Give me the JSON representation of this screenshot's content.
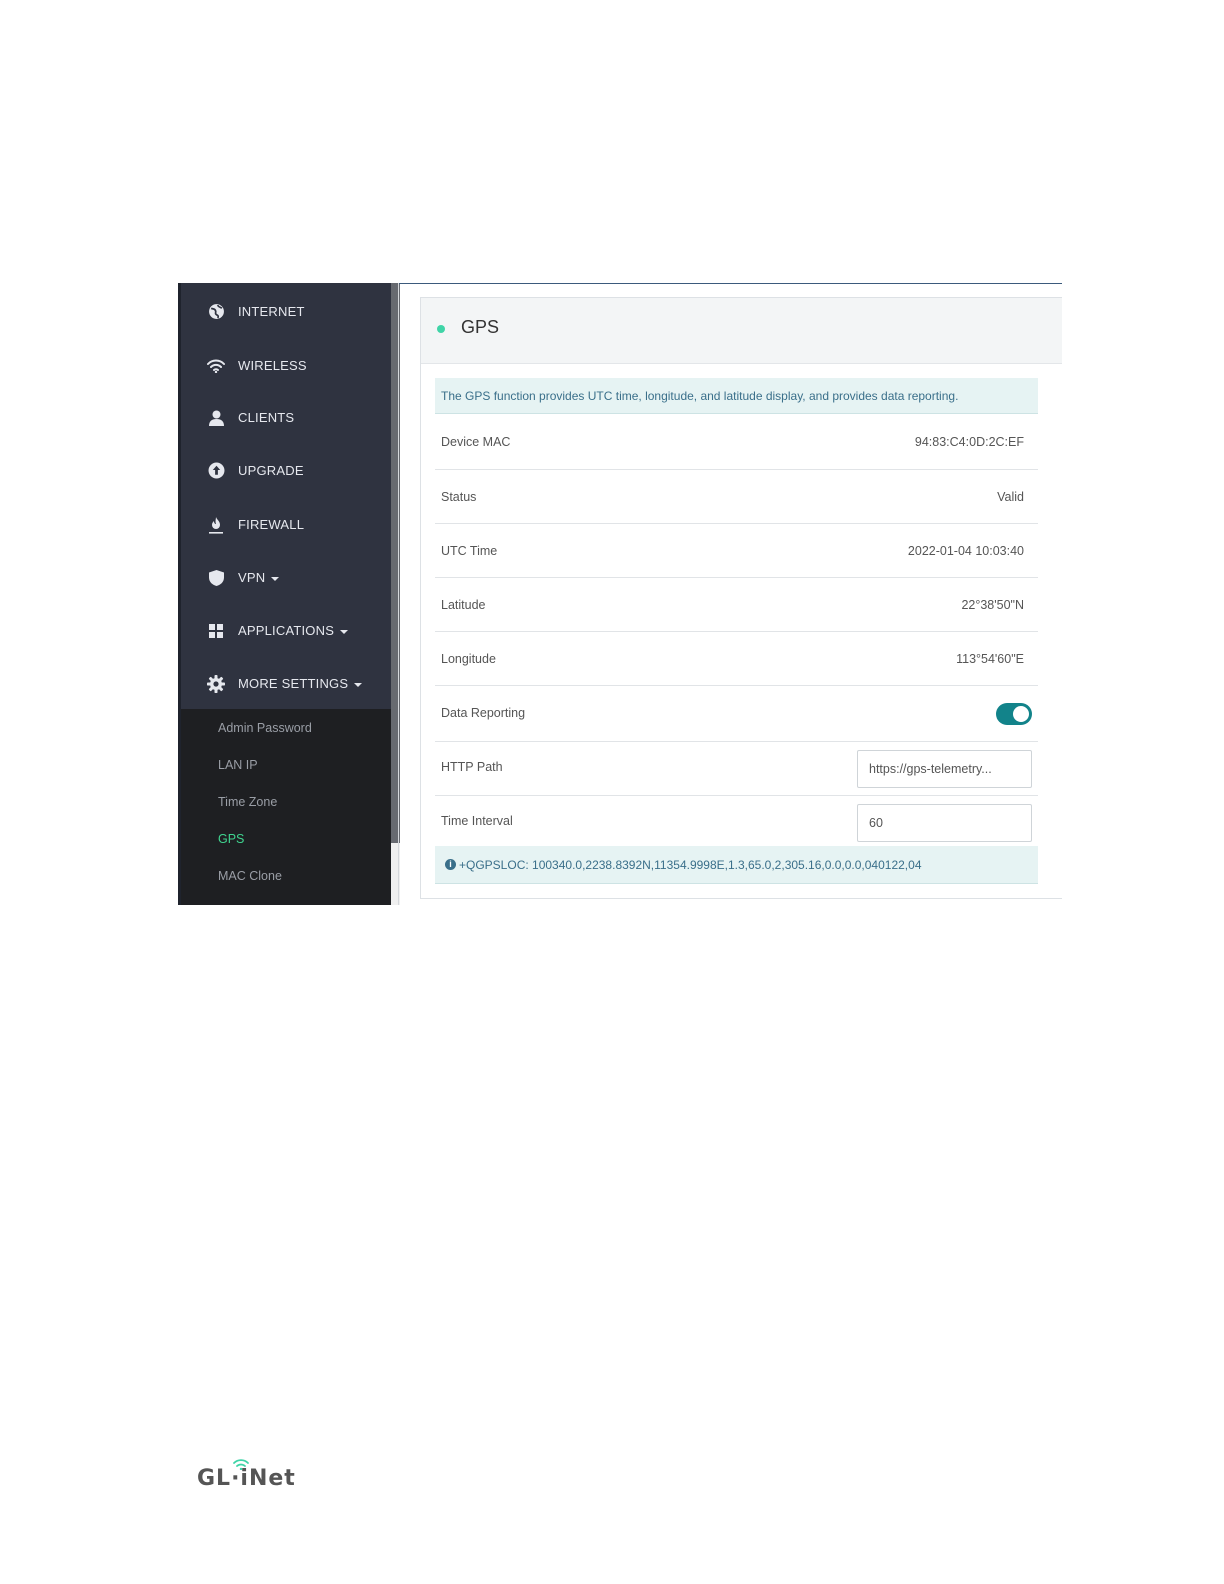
{
  "sidebar": {
    "items": [
      {
        "label": "INTERNET",
        "icon": "globe-icon"
      },
      {
        "label": "WIRELESS",
        "icon": "wifi-icon"
      },
      {
        "label": "CLIENTS",
        "icon": "user-icon"
      },
      {
        "label": "UPGRADE",
        "icon": "upload-icon"
      },
      {
        "label": "FIREWALL",
        "icon": "fire-icon"
      },
      {
        "label": "VPN",
        "icon": "shield-icon",
        "has_dropdown": true
      },
      {
        "label": "APPLICATIONS",
        "icon": "grid-icon",
        "has_dropdown": true
      },
      {
        "label": "MORE SETTINGS",
        "icon": "gear-icon",
        "has_dropdown": true
      }
    ],
    "submenu": [
      {
        "label": "Admin Password"
      },
      {
        "label": "LAN IP"
      },
      {
        "label": "Time Zone"
      },
      {
        "label": "GPS",
        "active": true
      },
      {
        "label": "MAC Clone"
      }
    ]
  },
  "panel": {
    "title": "GPS",
    "info": "The GPS function provides UTC time, longitude, and latitude display, and provides data reporting.",
    "rows": [
      {
        "label": "Device MAC",
        "value": "94:83:C4:0D:2C:EF"
      },
      {
        "label": "Status",
        "value": "Valid"
      },
      {
        "label": "UTC Time",
        "value": "2022-01-04 10:03:40"
      },
      {
        "label": "Latitude",
        "value": "22°38'50\"N"
      },
      {
        "label": "Longitude",
        "value": "113°54'60\"E"
      }
    ],
    "data_reporting": {
      "label": "Data Reporting",
      "enabled": true
    },
    "http_path": {
      "label": "HTTP Path",
      "value": "https://gps-telemetry..."
    },
    "time_interval": {
      "label": "Time Interval",
      "value": "60"
    },
    "nmea": "+QGPSLOC: 100340.0,2238.8392N,11354.9998E,1.3,65.0,2,305.16,0.0,0.0,040122,04"
  },
  "footer": {
    "logo": "GL·iNet"
  },
  "colors": {
    "sidebar_bg": "#2f3340",
    "submenu_bg": "#1e1f22",
    "active": "#3fd48f",
    "toggle": "#12838a",
    "info_bg": "#e6f3f3"
  }
}
